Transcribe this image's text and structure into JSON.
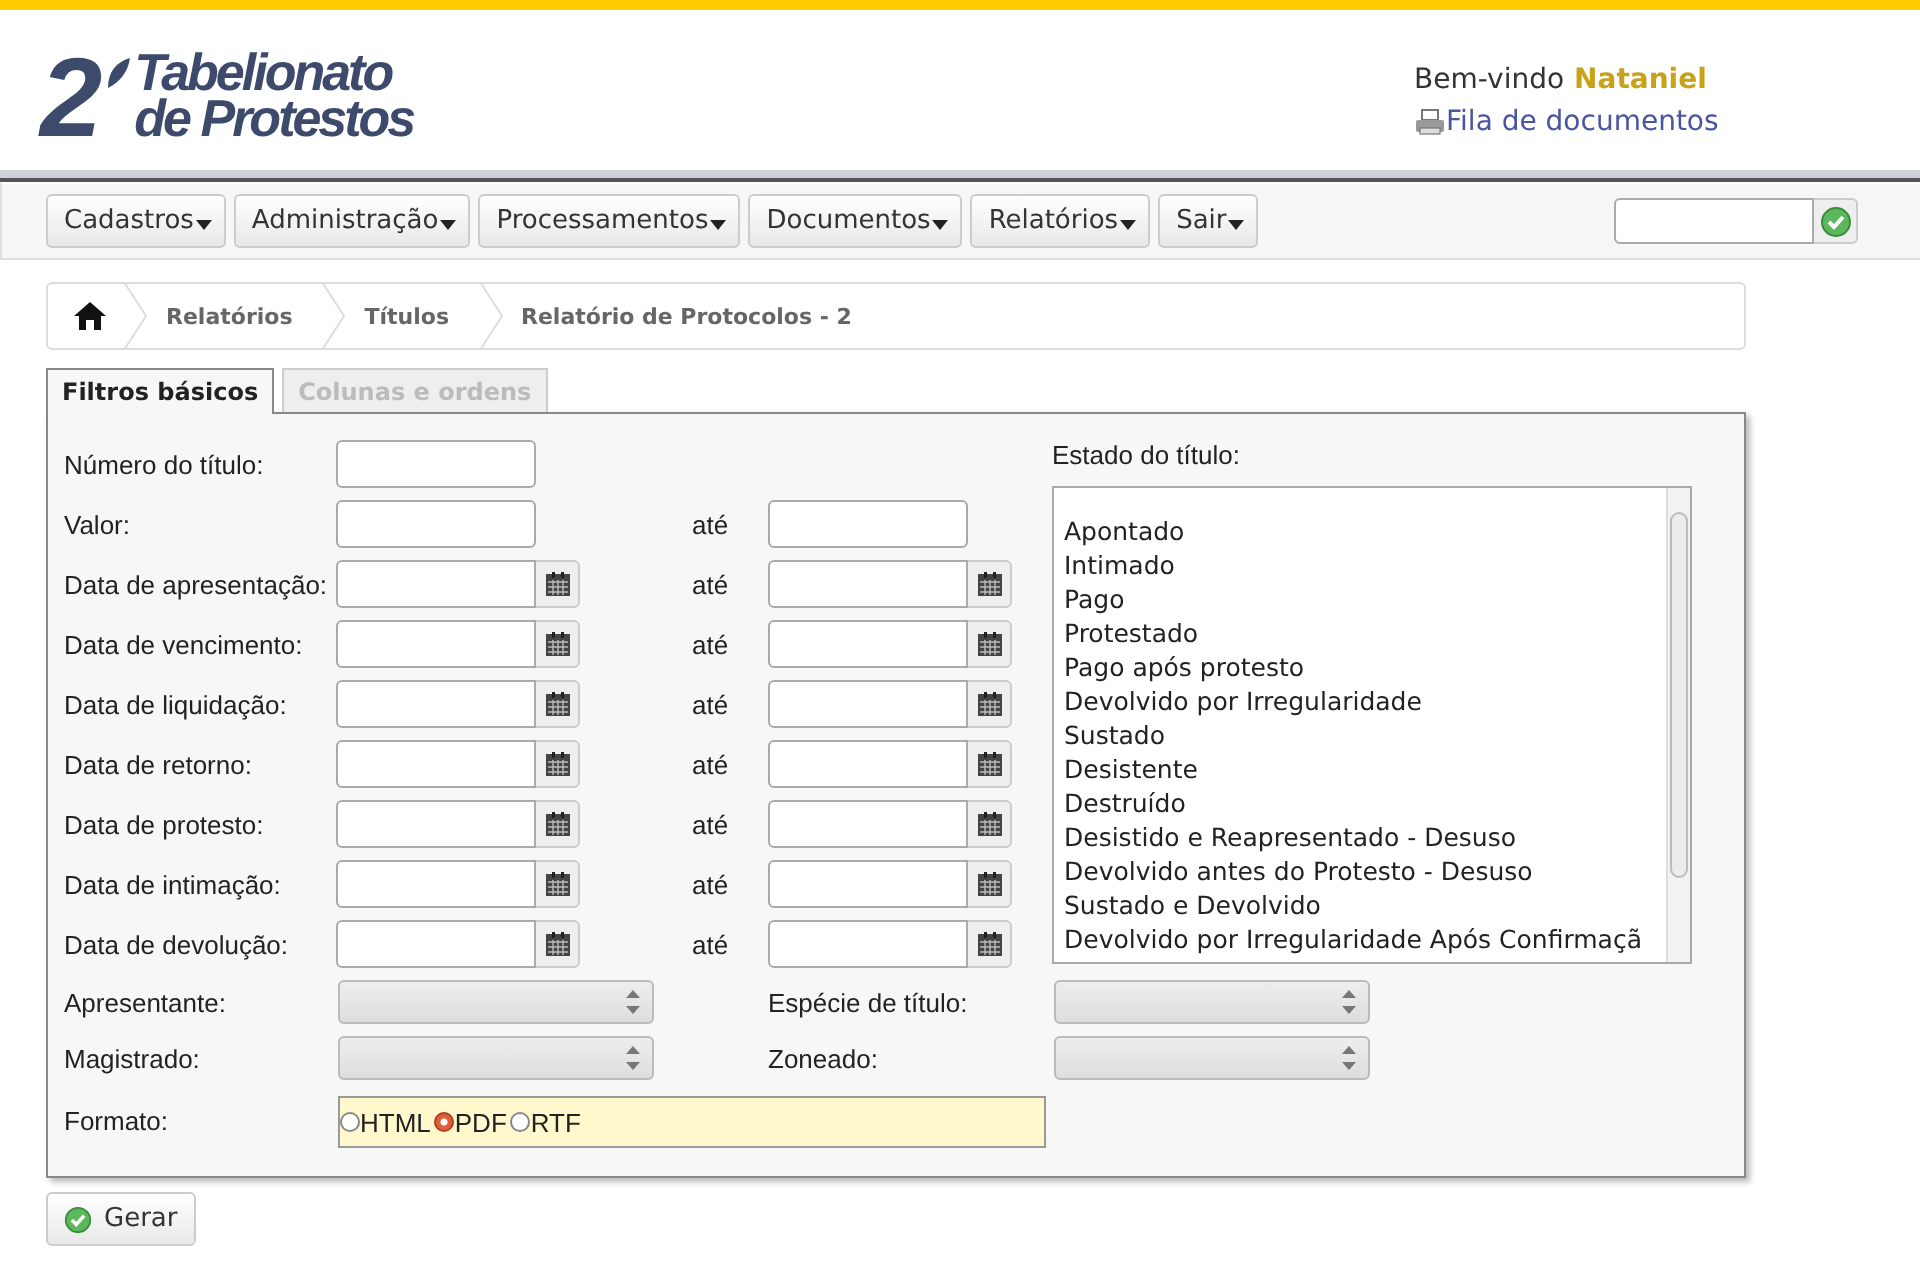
{
  "header": {
    "logo": {
      "numeral": "2",
      "line_1": "Tabelionato",
      "line_2": "de Protestos"
    },
    "greeting": "Bem-vindo",
    "user": "Nataniel",
    "documents_link": "Fila de documentos"
  },
  "menu": {
    "items": [
      "Cadastros",
      "Administração",
      "Processamentos",
      "Documentos",
      "Relatórios",
      "Sair"
    ],
    "search": {
      "kind": "field"
    }
  },
  "breadcrumb": [
    "Relatórios",
    "Títulos",
    "Relatório de Protocolos - 2"
  ],
  "tabs": [
    {
      "label": "Filtros básicos",
      "selected": true
    },
    {
      "label": "Colunas e ordens",
      "selected": false
    }
  ],
  "filters": [
    {
      "label": "Número do título:",
      "kind": "text"
    },
    {
      "label": "Valor:",
      "kind": "text-range",
      "to": "até"
    },
    {
      "label": "Data de apresentação:",
      "kind": "date-range",
      "to": "até"
    },
    {
      "label": "Data de vencimento:",
      "kind": "date-range",
      "to": "até"
    },
    {
      "label": "Data de liquidação:",
      "kind": "date-range",
      "to": "até"
    },
    {
      "label": "Data de retorno:",
      "kind": "date-range",
      "to": "até"
    },
    {
      "label": "Data de protesto:",
      "kind": "date-range",
      "to": "até"
    },
    {
      "label": "Data de intimação:",
      "kind": "date-range",
      "to": "até"
    },
    {
      "label": "Data de devolução:",
      "kind": "date-range",
      "to": "até"
    }
  ],
  "status": {
    "label": "Estado do título:",
    "options": [
      "Apontado",
      "Intimado",
      "Pago",
      "Protestado",
      "Pago após protesto",
      "Devolvido por Irregularidade",
      "Sustado",
      "Desistente",
      "Destruído",
      "Desistido e Reapresentado - Desuso",
      "Devolvido antes do Protesto - Desuso",
      "Sustado e Devolvido",
      "Devolvido por Irregularidade Após Confirmaçã"
    ]
  },
  "selects": [
    {
      "label": "Apresentante:"
    },
    {
      "label": "Espécie de título:"
    },
    {
      "label": "Magistrado:"
    },
    {
      "label": "Zoneado:"
    }
  ],
  "format": {
    "label": "Formato:",
    "options": [
      {
        "label": "HTML",
        "selected": false
      },
      {
        "label": "PDF",
        "selected": true
      },
      {
        "label": "RTF",
        "selected": false
      }
    ]
  },
  "generate_button": "Gerar"
}
